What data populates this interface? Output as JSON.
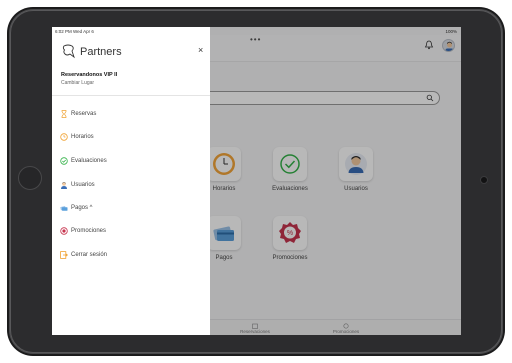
{
  "status_bar": {
    "time": "6:02 PM  Wed Apr 6",
    "battery": "100%",
    "dots": "•••"
  },
  "drawer": {
    "brand": "Partners",
    "close": "×",
    "venue_name": "Reservandonos VIP II",
    "change_place": "Cambiar Lugar",
    "items": [
      {
        "label": "Reservas",
        "icon": "hourglass-icon"
      },
      {
        "label": "Horarios",
        "icon": "clock-icon"
      },
      {
        "label": "Evaluaciones",
        "icon": "check-circle-icon"
      },
      {
        "label": "Usuarios",
        "icon": "user-icon"
      },
      {
        "label": "Pagos ^",
        "icon": "cards-icon"
      },
      {
        "label": "Promociones",
        "icon": "badge-icon"
      },
      {
        "label": "Cerrar sesión",
        "icon": "logout-icon"
      }
    ]
  },
  "dashboard": {
    "tiles": [
      {
        "label": "Horarios",
        "icon": "clock-icon"
      },
      {
        "label": "Evaluaciones",
        "icon": "check-circle-icon"
      },
      {
        "label": "Usuarios",
        "icon": "user-icon"
      },
      {
        "label": "Pagos",
        "icon": "cards-icon"
      },
      {
        "label": "Promociones",
        "icon": "promo-badge-icon"
      }
    ],
    "bottom_tabs": [
      {
        "label": "Reservaciones"
      },
      {
        "label": "Promociones"
      }
    ]
  },
  "colors": {
    "accent_orange": "#f0a232",
    "accent_green": "#35b34a",
    "accent_red": "#c7344e",
    "accent_blue": "#3a7bd5"
  }
}
